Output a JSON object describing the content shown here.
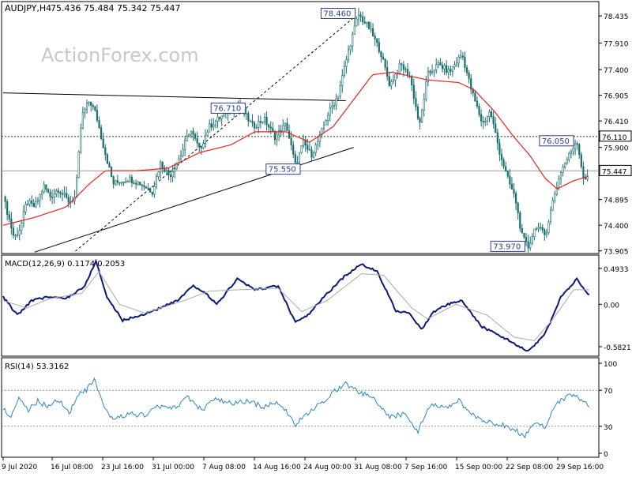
{
  "header": {
    "symbol": "AUDJPY,H4",
    "ohlc": "75.436 75.484 75.342 75.447"
  },
  "watermark": "ActionForex.com",
  "colors": {
    "background": "#ffffff",
    "candle": "#1a6e6e",
    "ma": "#e8231c",
    "macd": "#0b1a7a",
    "signal": "#aaaaaa",
    "rsi": "#2e86c1",
    "price_box": "#2c3e8c",
    "level_line": "#333333",
    "border": "#000000"
  },
  "chart_data": [
    {
      "type": "candlestick",
      "title": "AUDJPY,H4",
      "y_axis_ticks": [
        "78.435",
        "77.910",
        "77.400",
        "76.905",
        "76.410",
        "75.900",
        "75.447",
        "74.895",
        "74.400",
        "73.905"
      ],
      "x_axis_ticks": [
        "9 Jul 2020",
        "16 Jul 08:00",
        "23 Jul 16:00",
        "31 Jul 00:00",
        "7 Aug 08:00",
        "14 Aug 16:00",
        "24 Aug 00:00",
        "31 Aug 08:00",
        "7 Sep 16:00",
        "15 Sep 00:00",
        "22 Sep 08:00",
        "29 Sep 16:00"
      ],
      "ylim": [
        73.9,
        78.65
      ],
      "close_path": [
        {
          "t": 0,
          "v": 74.95
        },
        {
          "t": 8,
          "v": 74.5
        },
        {
          "t": 14,
          "v": 74.15
        },
        {
          "t": 22,
          "v": 74.35
        },
        {
          "t": 30,
          "v": 74.85
        },
        {
          "t": 40,
          "v": 74.75
        },
        {
          "t": 52,
          "v": 75.15
        },
        {
          "t": 60,
          "v": 74.95
        },
        {
          "t": 70,
          "v": 75.1
        },
        {
          "t": 84,
          "v": 74.85
        },
        {
          "t": 92,
          "v": 74.95
        },
        {
          "t": 100,
          "v": 76.5
        },
        {
          "t": 110,
          "v": 76.8
        },
        {
          "t": 118,
          "v": 76.55
        },
        {
          "t": 128,
          "v": 75.9
        },
        {
          "t": 140,
          "v": 75.2
        },
        {
          "t": 160,
          "v": 75.3
        },
        {
          "t": 175,
          "v": 75.2
        },
        {
          "t": 190,
          "v": 75.05
        },
        {
          "t": 200,
          "v": 75.6
        },
        {
          "t": 212,
          "v": 75.35
        },
        {
          "t": 226,
          "v": 75.75
        },
        {
          "t": 238,
          "v": 76.25
        },
        {
          "t": 250,
          "v": 75.85
        },
        {
          "t": 262,
          "v": 76.3
        },
        {
          "t": 282,
          "v": 76.55
        },
        {
          "t": 300,
          "v": 76.71
        },
        {
          "t": 318,
          "v": 76.3
        },
        {
          "t": 332,
          "v": 76.45
        },
        {
          "t": 346,
          "v": 76.1
        },
        {
          "t": 360,
          "v": 76.35
        },
        {
          "t": 372,
          "v": 75.55
        },
        {
          "t": 382,
          "v": 76.0
        },
        {
          "t": 392,
          "v": 75.75
        },
        {
          "t": 402,
          "v": 76.05
        },
        {
          "t": 412,
          "v": 76.5
        },
        {
          "t": 426,
          "v": 76.9
        },
        {
          "t": 440,
          "v": 77.8
        },
        {
          "t": 452,
          "v": 78.46
        },
        {
          "t": 466,
          "v": 78.2
        },
        {
          "t": 480,
          "v": 77.75
        },
        {
          "t": 492,
          "v": 77.1
        },
        {
          "t": 506,
          "v": 77.5
        },
        {
          "t": 518,
          "v": 77.25
        },
        {
          "t": 530,
          "v": 76.3
        },
        {
          "t": 540,
          "v": 77.3
        },
        {
          "t": 554,
          "v": 77.5
        },
        {
          "t": 568,
          "v": 77.35
        },
        {
          "t": 584,
          "v": 77.7
        },
        {
          "t": 596,
          "v": 77.0
        },
        {
          "t": 610,
          "v": 76.35
        },
        {
          "t": 620,
          "v": 76.6
        },
        {
          "t": 632,
          "v": 75.8
        },
        {
          "t": 642,
          "v": 75.3
        },
        {
          "t": 652,
          "v": 74.9
        },
        {
          "t": 660,
          "v": 74.2
        },
        {
          "t": 668,
          "v": 73.97
        },
        {
          "t": 678,
          "v": 74.4
        },
        {
          "t": 690,
          "v": 74.2
        },
        {
          "t": 700,
          "v": 74.9
        },
        {
          "t": 710,
          "v": 75.45
        },
        {
          "t": 722,
          "v": 75.8
        },
        {
          "t": 730,
          "v": 76.05
        },
        {
          "t": 740,
          "v": 75.2
        },
        {
          "t": 746,
          "v": 75.447
        }
      ],
      "ma_path": [
        {
          "t": 0,
          "v": 74.4
        },
        {
          "t": 40,
          "v": 74.55
        },
        {
          "t": 80,
          "v": 74.75
        },
        {
          "t": 110,
          "v": 75.2
        },
        {
          "t": 130,
          "v": 75.45
        },
        {
          "t": 170,
          "v": 75.45
        },
        {
          "t": 210,
          "v": 75.5
        },
        {
          "t": 250,
          "v": 75.8
        },
        {
          "t": 290,
          "v": 75.95
        },
        {
          "t": 320,
          "v": 76.2
        },
        {
          "t": 360,
          "v": 76.2
        },
        {
          "t": 390,
          "v": 76.0
        },
        {
          "t": 420,
          "v": 76.3
        },
        {
          "t": 445,
          "v": 76.8
        },
        {
          "t": 470,
          "v": 77.3
        },
        {
          "t": 495,
          "v": 77.35
        },
        {
          "t": 540,
          "v": 77.2
        },
        {
          "t": 580,
          "v": 77.15
        },
        {
          "t": 600,
          "v": 77.0
        },
        {
          "t": 625,
          "v": 76.6
        },
        {
          "t": 650,
          "v": 76.1
        },
        {
          "t": 670,
          "v": 75.75
        },
        {
          "t": 690,
          "v": 75.3
        },
        {
          "t": 705,
          "v": 75.1
        },
        {
          "t": 725,
          "v": 75.25
        },
        {
          "t": 746,
          "v": 75.35
        }
      ],
      "annotations": [
        {
          "label": "78.460",
          "t": 452,
          "v": 78.46
        },
        {
          "label": "76.710",
          "t": 300,
          "v": 76.71
        },
        {
          "label": "75.550",
          "t": 372,
          "v": 75.55
        },
        {
          "label": "76.050",
          "t": 730,
          "v": 76.05
        },
        {
          "label": "73.970",
          "t": 668,
          "v": 73.97
        }
      ],
      "levels": [
        {
          "label": "76.110",
          "v": 76.11,
          "style": "dotted"
        },
        {
          "label": "75.447",
          "v": 75.447,
          "style": "solid",
          "current": true
        }
      ],
      "trendlines": [
        {
          "from": {
            "t": 0,
            "v": 76.95
          },
          "to": {
            "t": 436,
            "v": 76.8
          },
          "style": "solid"
        },
        {
          "from": {
            "t": 40,
            "v": 73.88
          },
          "to": {
            "t": 446,
            "v": 75.9
          },
          "style": "solid"
        },
        {
          "from": {
            "t": 92,
            "v": 73.9
          },
          "to": {
            "t": 446,
            "v": 78.4
          },
          "style": "dashed"
        }
      ]
    },
    {
      "type": "line",
      "title": "MACD(12,26,9) 0.1174 0.2053",
      "y_axis_ticks": [
        "0.4933",
        "0.00",
        "-0.5821"
      ],
      "ylim": [
        -0.68,
        0.6
      ],
      "series": [
        {
          "role": "macd",
          "points": [
            {
              "t": 0,
              "v": 0.1
            },
            {
              "t": 18,
              "v": -0.15
            },
            {
              "t": 36,
              "v": 0.05
            },
            {
              "t": 56,
              "v": 0.1
            },
            {
              "t": 80,
              "v": 0.08
            },
            {
              "t": 104,
              "v": 0.25
            },
            {
              "t": 118,
              "v": 0.6
            },
            {
              "t": 132,
              "v": 0.1
            },
            {
              "t": 152,
              "v": -0.22
            },
            {
              "t": 176,
              "v": -0.15
            },
            {
              "t": 200,
              "v": -0.05
            },
            {
              "t": 222,
              "v": 0.05
            },
            {
              "t": 242,
              "v": 0.25
            },
            {
              "t": 258,
              "v": 0.15
            },
            {
              "t": 272,
              "v": 0.0
            },
            {
              "t": 298,
              "v": 0.35
            },
            {
              "t": 320,
              "v": 0.2
            },
            {
              "t": 350,
              "v": 0.25
            },
            {
              "t": 372,
              "v": -0.25
            },
            {
              "t": 388,
              "v": -0.15
            },
            {
              "t": 408,
              "v": 0.1
            },
            {
              "t": 436,
              "v": 0.4
            },
            {
              "t": 456,
              "v": 0.55
            },
            {
              "t": 476,
              "v": 0.45
            },
            {
              "t": 500,
              "v": -0.1
            },
            {
              "t": 518,
              "v": -0.12
            },
            {
              "t": 532,
              "v": -0.35
            },
            {
              "t": 548,
              "v": -0.1
            },
            {
              "t": 566,
              "v": 0.0
            },
            {
              "t": 584,
              "v": 0.05
            },
            {
              "t": 608,
              "v": -0.3
            },
            {
              "t": 636,
              "v": -0.45
            },
            {
              "t": 668,
              "v": -0.65
            },
            {
              "t": 690,
              "v": -0.4
            },
            {
              "t": 710,
              "v": 0.1
            },
            {
              "t": 730,
              "v": 0.35
            },
            {
              "t": 746,
              "v": 0.12
            }
          ]
        },
        {
          "role": "signal",
          "points": [
            {
              "t": 0,
              "v": 0.05
            },
            {
              "t": 30,
              "v": -0.05
            },
            {
              "t": 60,
              "v": 0.08
            },
            {
              "t": 100,
              "v": 0.15
            },
            {
              "t": 122,
              "v": 0.45
            },
            {
              "t": 148,
              "v": 0.0
            },
            {
              "t": 180,
              "v": -0.12
            },
            {
              "t": 230,
              "v": 0.05
            },
            {
              "t": 262,
              "v": 0.18
            },
            {
              "t": 300,
              "v": 0.2
            },
            {
              "t": 350,
              "v": 0.22
            },
            {
              "t": 380,
              "v": -0.1
            },
            {
              "t": 412,
              "v": 0.05
            },
            {
              "t": 456,
              "v": 0.42
            },
            {
              "t": 484,
              "v": 0.4
            },
            {
              "t": 520,
              "v": -0.05
            },
            {
              "t": 540,
              "v": -0.2
            },
            {
              "t": 576,
              "v": 0.0
            },
            {
              "t": 616,
              "v": -0.15
            },
            {
              "t": 650,
              "v": -0.45
            },
            {
              "t": 676,
              "v": -0.5
            },
            {
              "t": 700,
              "v": -0.2
            },
            {
              "t": 726,
              "v": 0.2
            },
            {
              "t": 746,
              "v": 0.2
            }
          ]
        }
      ]
    },
    {
      "type": "line",
      "title": "RSI(14) 53.3162",
      "y_axis_ticks": [
        "100",
        "70",
        "30",
        "0"
      ],
      "ylim": [
        0,
        100
      ],
      "levels": [
        70,
        30
      ],
      "series": [
        {
          "role": "rsi",
          "points": [
            {
              "t": 0,
              "v": 50
            },
            {
              "t": 10,
              "v": 40
            },
            {
              "t": 20,
              "v": 62
            },
            {
              "t": 32,
              "v": 48
            },
            {
              "t": 44,
              "v": 58
            },
            {
              "t": 56,
              "v": 52
            },
            {
              "t": 70,
              "v": 60
            },
            {
              "t": 84,
              "v": 45
            },
            {
              "t": 96,
              "v": 65
            },
            {
              "t": 106,
              "v": 70
            },
            {
              "t": 116,
              "v": 82
            },
            {
              "t": 128,
              "v": 50
            },
            {
              "t": 140,
              "v": 38
            },
            {
              "t": 160,
              "v": 44
            },
            {
              "t": 180,
              "v": 42
            },
            {
              "t": 196,
              "v": 52
            },
            {
              "t": 216,
              "v": 50
            },
            {
              "t": 236,
              "v": 62
            },
            {
              "t": 252,
              "v": 48
            },
            {
              "t": 270,
              "v": 60
            },
            {
              "t": 290,
              "v": 55
            },
            {
              "t": 310,
              "v": 58
            },
            {
              "t": 330,
              "v": 52
            },
            {
              "t": 352,
              "v": 56
            },
            {
              "t": 372,
              "v": 32
            },
            {
              "t": 390,
              "v": 45
            },
            {
              "t": 412,
              "v": 62
            },
            {
              "t": 436,
              "v": 78
            },
            {
              "t": 452,
              "v": 68
            },
            {
              "t": 470,
              "v": 62
            },
            {
              "t": 492,
              "v": 40
            },
            {
              "t": 510,
              "v": 44
            },
            {
              "t": 528,
              "v": 25
            },
            {
              "t": 544,
              "v": 55
            },
            {
              "t": 560,
              "v": 50
            },
            {
              "t": 580,
              "v": 58
            },
            {
              "t": 600,
              "v": 40
            },
            {
              "t": 620,
              "v": 35
            },
            {
              "t": 640,
              "v": 30
            },
            {
              "t": 664,
              "v": 20
            },
            {
              "t": 676,
              "v": 35
            },
            {
              "t": 690,
              "v": 30
            },
            {
              "t": 704,
              "v": 55
            },
            {
              "t": 722,
              "v": 65
            },
            {
              "t": 734,
              "v": 60
            },
            {
              "t": 746,
              "v": 53
            }
          ]
        }
      ]
    }
  ]
}
